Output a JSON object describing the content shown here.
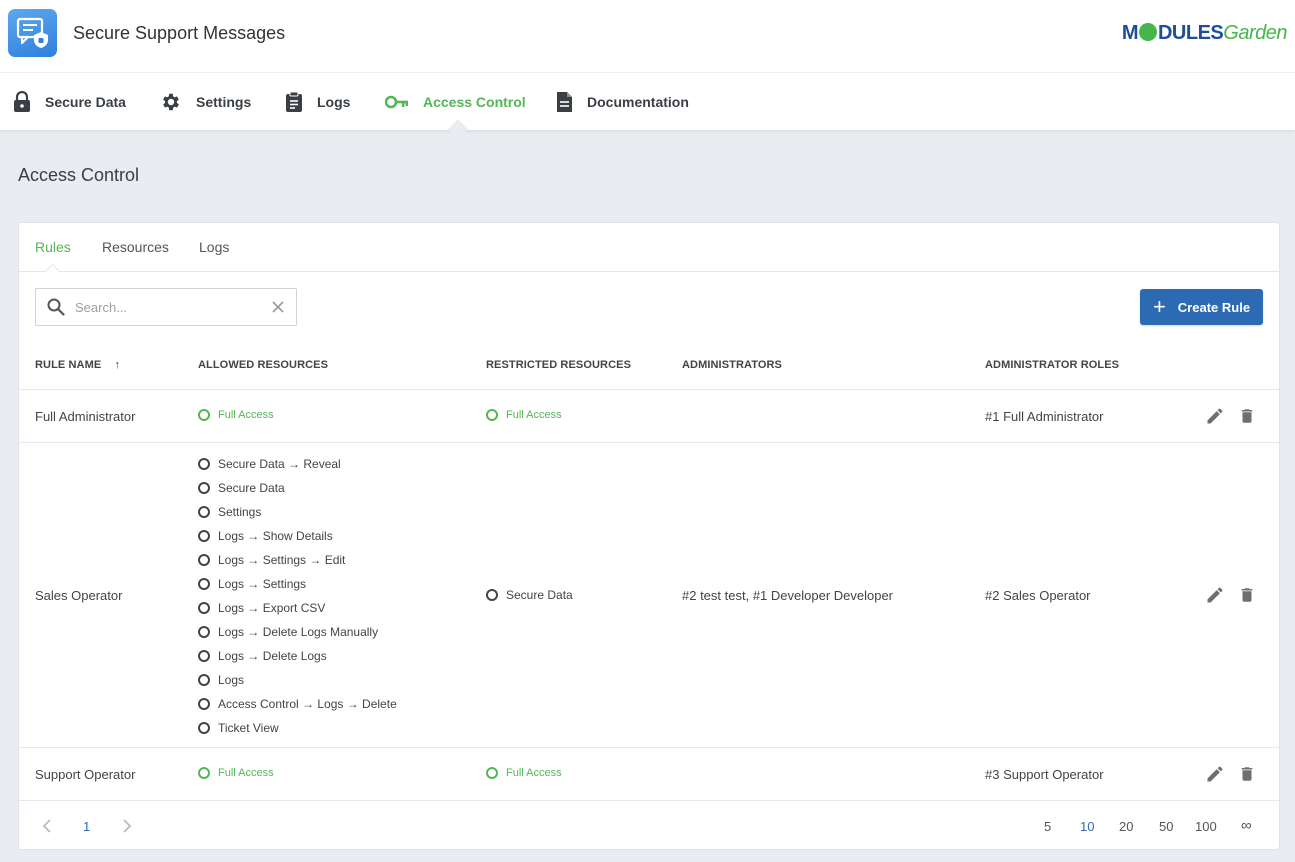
{
  "app": {
    "title": "Secure Support Messages",
    "brand_a": "M",
    "brand_b": "DULES",
    "brand_c": "Garden"
  },
  "nav": [
    {
      "label": "Secure Data",
      "icon": "lock-icon"
    },
    {
      "label": "Settings",
      "icon": "gear-icon"
    },
    {
      "label": "Logs",
      "icon": "clipboard-icon"
    },
    {
      "label": "Access Control",
      "icon": "key-icon",
      "active": true
    },
    {
      "label": "Documentation",
      "icon": "document-icon"
    }
  ],
  "page": {
    "title": "Access Control"
  },
  "tabs": [
    {
      "label": "Rules",
      "active": true
    },
    {
      "label": "Resources"
    },
    {
      "label": "Logs"
    }
  ],
  "search": {
    "placeholder": "Search...",
    "value": ""
  },
  "create_button": "Create Rule",
  "table": {
    "headers": {
      "rule_name": "RULE NAME",
      "sort_indicator": "↑",
      "allowed": "ALLOWED RESOURCES",
      "restricted": "RESTRICTED RESOURCES",
      "administrators": "ADMINISTRATORS",
      "roles": "ADMINISTRATOR ROLES"
    },
    "rows": [
      {
        "name": "Full Administrator",
        "allowed": [
          "Full Access"
        ],
        "restricted": [
          "Full Access"
        ],
        "administrators": "",
        "roles": "#1 Full Administrator"
      },
      {
        "name": "Sales Operator",
        "allowed": [
          "Secure Data → Reveal",
          "Secure Data",
          "Settings",
          "Logs → Show Details",
          "Logs → Settings → Edit",
          "Logs → Settings",
          "Logs → Export CSV",
          "Logs → Delete Logs Manually",
          "Logs → Delete Logs",
          "Logs",
          "Access Control → Logs → Delete",
          "Ticket View"
        ],
        "restricted": [
          "Secure Data"
        ],
        "administrators": "#2 test test, #1 Developer Developer",
        "roles": "#2 Sales Operator"
      },
      {
        "name": "Support Operator",
        "allowed": [
          "Full Access"
        ],
        "restricted": [
          "Full Access"
        ],
        "administrators": "",
        "roles": "#3 Support Operator"
      }
    ]
  },
  "pagination": {
    "current_page": "1",
    "page_sizes": [
      "5",
      "10",
      "20",
      "50",
      "100",
      "∞"
    ],
    "active_size": "10"
  },
  "colors": {
    "accent_green": "#53b657",
    "primary_blue": "#2c6bb3"
  }
}
